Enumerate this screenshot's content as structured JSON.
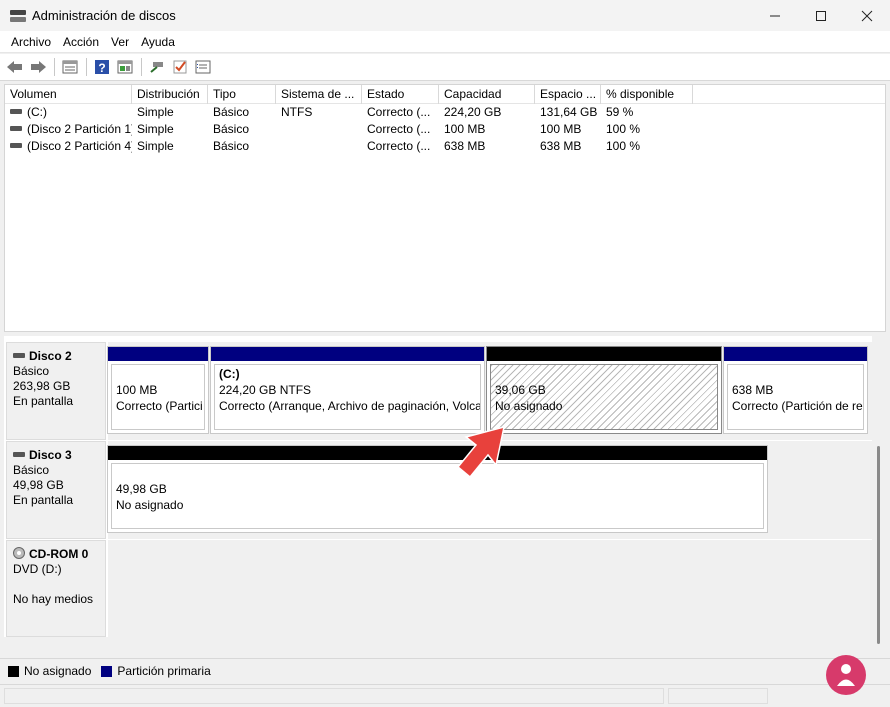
{
  "window": {
    "title": "Administración de discos"
  },
  "menu": [
    "Archivo",
    "Acción",
    "Ver",
    "Ayuda"
  ],
  "toolbar": {
    "icons": [
      "back-icon",
      "forward-icon",
      "view-list-icon",
      "help-icon",
      "view-graph-icon",
      "connect-icon",
      "check-icon",
      "properties-icon"
    ]
  },
  "volume_list": {
    "columns": [
      "Volumen",
      "Distribución",
      "Tipo",
      "Sistema de ...",
      "Estado",
      "Capacidad",
      "Espacio ...",
      "% disponible"
    ],
    "rows": [
      {
        "volumen": "(C:)",
        "distribucion": "Simple",
        "tipo": "Básico",
        "sistema": "NTFS",
        "estado": "Correcto (...",
        "capacidad": "224,20 GB",
        "espacio": "131,64 GB",
        "disponible": "59 %"
      },
      {
        "volumen": "(Disco 2 Partición 1)",
        "distribucion": "Simple",
        "tipo": "Básico",
        "sistema": "",
        "estado": "Correcto (...",
        "capacidad": "100 MB",
        "espacio": "100 MB",
        "disponible": "100 %"
      },
      {
        "volumen": "(Disco 2 Partición 4)",
        "distribucion": "Simple",
        "tipo": "Básico",
        "sistema": "",
        "estado": "Correcto (...",
        "capacidad": "638 MB",
        "espacio": "638 MB",
        "disponible": "100 %"
      }
    ]
  },
  "disks": {
    "disk2": {
      "name": "Disco 2",
      "type": "Básico",
      "size": "263,98 GB",
      "status": "En pantalla",
      "partitions": [
        {
          "title": "",
          "line1": "100 MB",
          "line2": "Correcto (Partici"
        },
        {
          "title": "(C:)",
          "line1": "224,20 GB NTFS",
          "line2": "Correcto (Arranque, Archivo de paginación, Volca"
        },
        {
          "title": "",
          "line1": "39,06 GB",
          "line2": "No asignado"
        },
        {
          "title": "",
          "line1": "638 MB",
          "line2": "Correcto (Partición de re"
        }
      ]
    },
    "disk3": {
      "name": "Disco 3",
      "type": "Básico",
      "size": "49,98 GB",
      "status": "En pantalla",
      "partitions": [
        {
          "title": "",
          "line1": "49,98 GB",
          "line2": "No asignado"
        }
      ]
    },
    "cdrom": {
      "name": "CD-ROM 0",
      "type": "DVD (D:)",
      "status": "No hay medios"
    }
  },
  "legend": [
    {
      "label": "No asignado",
      "color": "#000000"
    },
    {
      "label": "Partición primaria",
      "color": "#000080"
    }
  ],
  "colors": {
    "primary_partition": "#000080",
    "unallocated": "#000000",
    "arrow": "#e8413c"
  }
}
